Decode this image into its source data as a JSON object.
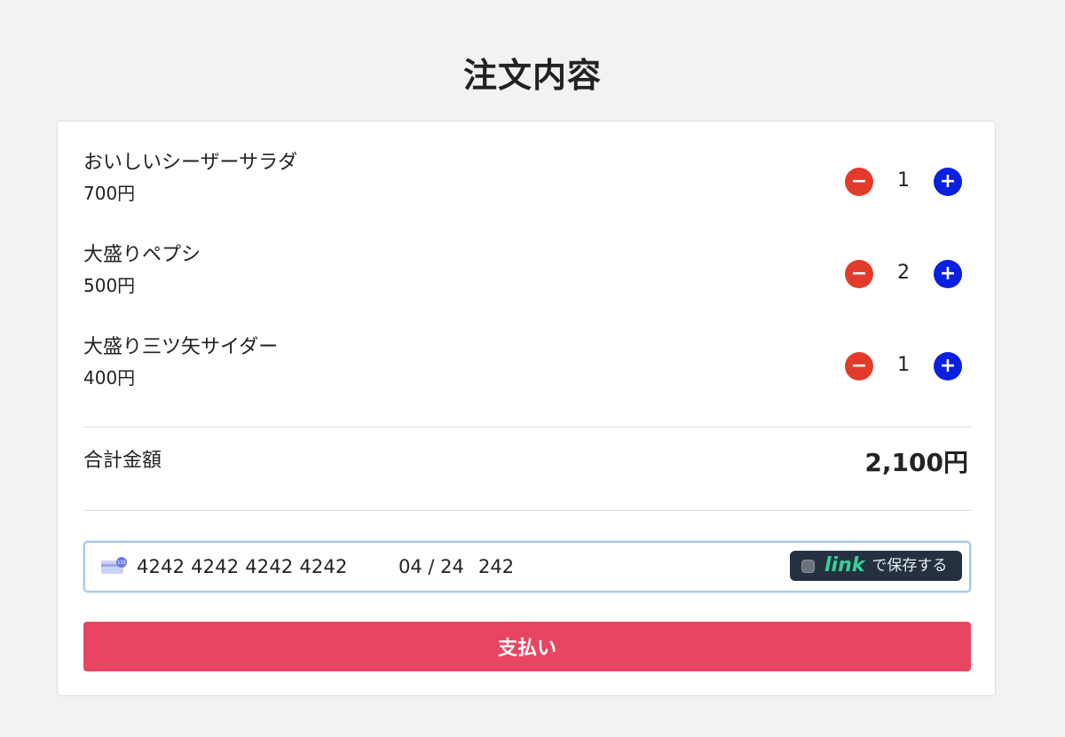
{
  "header": {
    "title": "注文内容"
  },
  "order": {
    "items": [
      {
        "name": "おいしいシーザーサラダ",
        "price": "700円",
        "quantity": "1"
      },
      {
        "name": "大盛りペプシ",
        "price": "500円",
        "quantity": "2"
      },
      {
        "name": "大盛り三ツ矢サイダー",
        "price": "400円",
        "quantity": "1"
      }
    ],
    "stepper": {
      "minus_label": "−",
      "plus_label": "+",
      "minus_icon": "minus-icon",
      "plus_icon": "plus-icon",
      "minus_color": "#e33b2a",
      "plus_color": "#0a1fe0"
    },
    "total_label": "合計金額",
    "total_value": "2,100円"
  },
  "payment": {
    "card_number": "4242 4242 4242 4242",
    "expiry": "04 / 24",
    "cvc": "242",
    "card_icon": "credit-card-icon",
    "card_icon_badge": "135",
    "link_logo": "link",
    "link_label": "で保存する",
    "link_accent": "#34d399"
  },
  "actions": {
    "pay_label": "支払い",
    "pay_color": "#e84562"
  }
}
